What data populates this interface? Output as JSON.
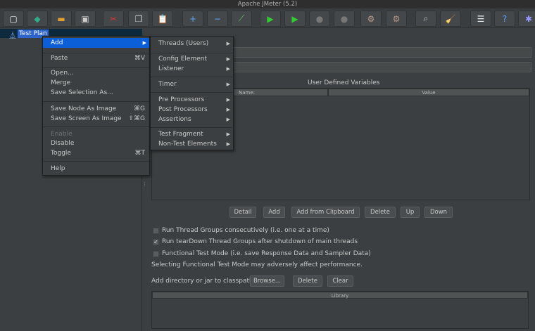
{
  "window": {
    "title": "Apache JMeter (5.2)"
  },
  "toolbar": [
    {
      "icon": "new-icon",
      "glyph": "▢",
      "color": "#eee"
    },
    {
      "icon": "templates-icon",
      "glyph": "◆",
      "color": "#3a8"
    },
    {
      "icon": "open-icon",
      "glyph": "▬",
      "color": "#e0a030"
    },
    {
      "icon": "save-icon",
      "glyph": "▣",
      "color": "#ccc"
    },
    {
      "icon": "cut-icon",
      "glyph": "✂",
      "color": "#d33"
    },
    {
      "icon": "copy-icon",
      "glyph": "❐",
      "color": "#ccc"
    },
    {
      "icon": "paste-icon",
      "glyph": "📋",
      "color": "#c96"
    },
    {
      "icon": "expand-icon",
      "glyph": "+",
      "color": "#5aa7ff"
    },
    {
      "icon": "collapse-icon",
      "glyph": "−",
      "color": "#5aa7ff"
    },
    {
      "icon": "toggle-icon",
      "glyph": "⟋",
      "color": "#6c6"
    },
    {
      "icon": "start-icon",
      "glyph": "▶",
      "color": "#3c3"
    },
    {
      "icon": "start-no-pauses-icon",
      "glyph": "▶",
      "color": "#3c3"
    },
    {
      "icon": "stop-icon",
      "glyph": "●",
      "color": "#777"
    },
    {
      "icon": "shutdown-icon",
      "glyph": "●",
      "color": "#777"
    },
    {
      "icon": "clear-icon",
      "glyph": "⚙",
      "color": "#b98"
    },
    {
      "icon": "clear-all-icon",
      "glyph": "⚙",
      "color": "#b98"
    },
    {
      "icon": "search-icon",
      "glyph": "⌕",
      "color": "#ccc"
    },
    {
      "icon": "reset-search-icon",
      "glyph": "🧹",
      "color": "#eb3"
    },
    {
      "icon": "function-helper-icon",
      "glyph": "☰",
      "color": "#eee"
    },
    {
      "icon": "help-icon",
      "glyph": "?",
      "color": "#5aa7ff"
    },
    {
      "icon": "remote-icon",
      "glyph": "✱",
      "color": "#99f"
    }
  ],
  "tree": {
    "root": "Test Plan"
  },
  "context_menu": {
    "items": [
      {
        "label": "Add",
        "shortcut": "",
        "submenu": true
      },
      {
        "label": "Paste",
        "shortcut": "⌘V"
      },
      {
        "label": "Open..."
      },
      {
        "label": "Merge"
      },
      {
        "label": "Save Selection As..."
      },
      {
        "label": "Save Node As Image",
        "shortcut": "⌘G"
      },
      {
        "label": "Save Screen As Image",
        "shortcut": "⇧⌘G"
      },
      {
        "label": "Enable",
        "disabled": true
      },
      {
        "label": "Disable"
      },
      {
        "label": "Toggle",
        "shortcut": "⌘T"
      },
      {
        "label": "Help"
      }
    ]
  },
  "submenu": {
    "items": [
      "Threads (Users)",
      "Config Element",
      "Listener",
      "Timer",
      "Pre Processors",
      "Post Processors",
      "Assertions",
      "Test Fragment",
      "Non-Test Elements"
    ]
  },
  "main": {
    "udv_title": "User Defined Variables",
    "udv_columns": [
      "Name:",
      "Value"
    ],
    "buttons": [
      "Detail",
      "Add",
      "Add from Clipboard",
      "Delete",
      "Up",
      "Down"
    ],
    "checkboxes": [
      {
        "label": "Run Thread Groups consecutively (i.e. one at a time)",
        "checked": false
      },
      {
        "label": "Run tearDown Thread Groups after shutdown of main threads",
        "checked": true
      },
      {
        "label": "Functional Test Mode (i.e. save Response Data and Sampler Data)",
        "checked": false
      }
    ],
    "warning": "Selecting Functional Test Mode may adversely affect performance.",
    "classpath_label": "Add directory or jar to classpath",
    "classpath_buttons": [
      "Browse...",
      "Delete",
      "Clear"
    ],
    "library_column": "Library"
  }
}
